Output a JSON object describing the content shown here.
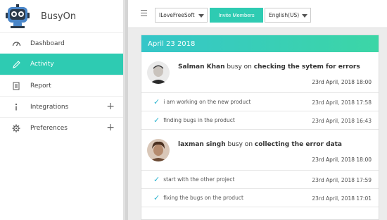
{
  "brand": {
    "name": "BusyOn"
  },
  "sidebar": {
    "items": [
      {
        "label": "Dashboard",
        "icon": "dashboard-gauge-icon",
        "active": false,
        "expandable": false
      },
      {
        "label": "Activity",
        "icon": "pencil-icon",
        "active": true,
        "expandable": false
      },
      {
        "label": "Report",
        "icon": "report-icon",
        "active": false,
        "expandable": false
      },
      {
        "label": "Integrations",
        "icon": "info-icon",
        "active": false,
        "expandable": true
      },
      {
        "label": "Preferences",
        "icon": "gear-icon",
        "active": false,
        "expandable": true
      }
    ],
    "expand_symbol": "+"
  },
  "topbar": {
    "workspace_select": "ILoveFreeSoft",
    "invite_label": "Invite Members",
    "language_select": "English(US)"
  },
  "feed": {
    "date_heading": "April 23 2018",
    "entries": [
      {
        "user": "Salman Khan",
        "verb": " busy on ",
        "subject": "checking the sytem for errors",
        "time": "23rd April, 2018 18:00",
        "tasks": [
          {
            "text": "i am working on the new product",
            "time": "23rd April, 2018 17:58"
          },
          {
            "text": "finding bugs in the product",
            "time": "23rd April, 2018 16:43"
          }
        ]
      },
      {
        "user": "laxman singh",
        "verb": " busy on ",
        "subject": "collecting the error data",
        "time": "23rd April, 2018 18:00",
        "tasks": [
          {
            "text": "start with the other project",
            "time": "23rd April, 2018 17:59"
          },
          {
            "text": "fixing the bugs on the product",
            "time": "23rd April, 2018 17:01"
          }
        ]
      }
    ]
  },
  "colors": {
    "accent": "#2ecbb2",
    "check": "#2eb5d0",
    "gradient_start": "#35c6c9",
    "gradient_end": "#3cd6a6"
  }
}
